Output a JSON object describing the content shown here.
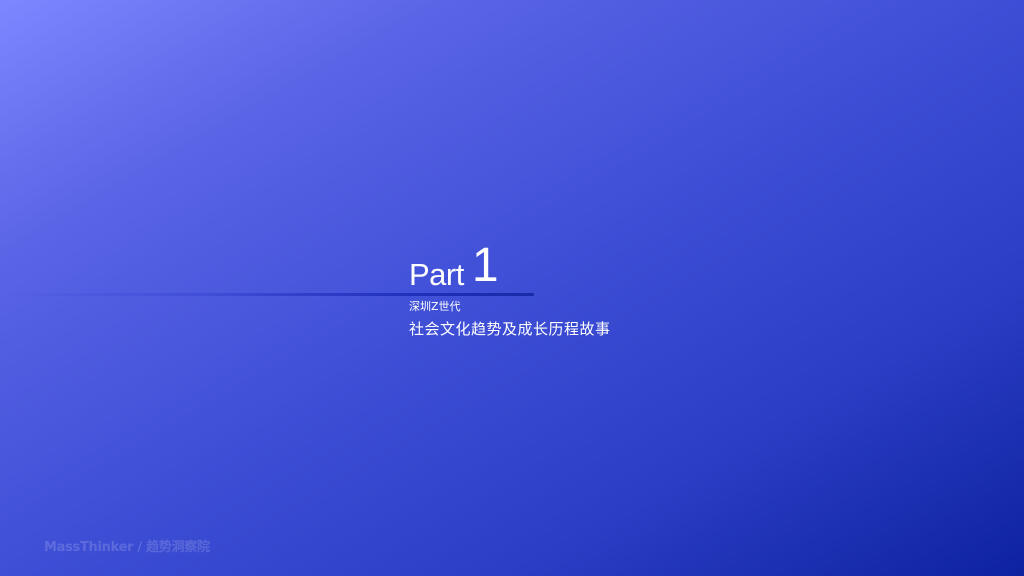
{
  "slide": {
    "part_word": "Part",
    "part_number": "1",
    "subtitle_small": "深圳Z世代",
    "subtitle_large": "社会文化趋势及成长历程故事",
    "watermark": "MassThinker / 趋势洞察院"
  },
  "colors": {
    "background_start": "#7d87ff",
    "background_end": "#0d22a0",
    "accent_line": "#1f2fb8",
    "text": "#ffffff"
  }
}
